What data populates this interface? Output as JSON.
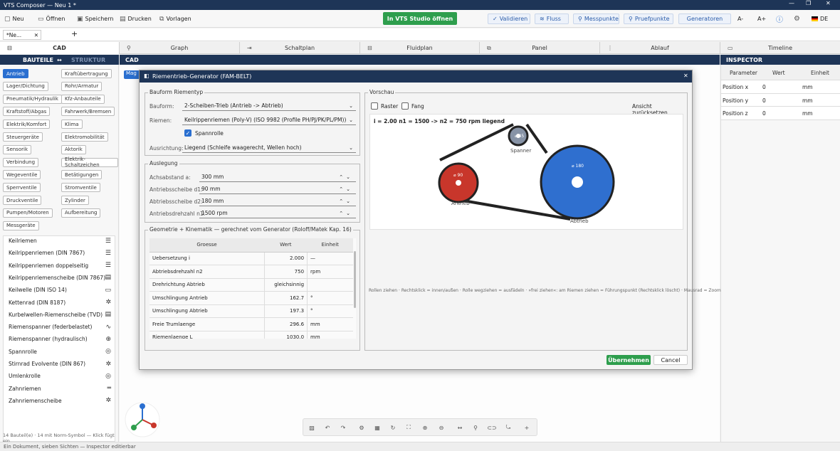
{
  "window": {
    "title": "VTS Composer — Neu 1 *",
    "min": "—",
    "max": "❐",
    "close": "✕"
  },
  "toolbar": {
    "new": "Neu",
    "open": "Öffnen",
    "save": "Speichern",
    "print": "Drucken",
    "templates": "Vorlagen",
    "open_studio": "In VTS Studio öffnen",
    "validate": "Validieren",
    "flow": "Fluss",
    "measure_points": "Messpunkte",
    "check_points": "Pruefpunkte",
    "generators": "Generatoren",
    "font_smaller": "A-",
    "font_larger": "A+",
    "language": "DE"
  },
  "doc_tabs": {
    "active": "*Ne...",
    "close": "✕",
    "add": "+"
  },
  "views": {
    "cad": "CAD",
    "graph": "Graph",
    "schaltplan": "Schaltplan",
    "fluidplan": "Fluidplan",
    "panel": "Panel",
    "ablauf": "Ablauf",
    "timeline": "Timeline"
  },
  "nav": {
    "bauteile": "BAUTEILE",
    "swap": "↔",
    "struktur": "STRUKTUR",
    "cad": "CAD",
    "inspector": "INSPECTOR",
    "mag": "Mag"
  },
  "categories": [
    "Antrieb",
    "Kraftübertragung",
    "Lager/Dichtung",
    "Rohr/Armatur",
    "Pneumatik/Hydraulik",
    "Kfz-Anbauteile",
    "Kraftstoff/Abgas",
    "Fahrwerk/Bremsen",
    "Elektrik/Komfort",
    "Klima",
    "Steuergeräte",
    "Elektromobilität",
    "Sensorik",
    "Aktorik",
    "Verbindung",
    "Elektrik-Schaltzeichen",
    "Wegeventile",
    "Betätigungen",
    "Sperrventile",
    "Stromventile",
    "Druckventile",
    "Zylinder",
    "Pumpen/Motoren",
    "Aufbereitung",
    "Messgeräte"
  ],
  "components": [
    {
      "label": "Keilriemen",
      "icon": "☰"
    },
    {
      "label": "Keilrippenriemen (DIN 7867)",
      "icon": "☰"
    },
    {
      "label": "Keilrippenriemen doppelseitig",
      "icon": "☰"
    },
    {
      "label": "Keilrippenriemenscheibe (DIN 7867)",
      "icon": "▤"
    },
    {
      "label": "Keilwelle (DIN ISO 14)",
      "icon": "▭"
    },
    {
      "label": "Kettenrad (DIN 8187)",
      "icon": "✲"
    },
    {
      "label": "Kurbelwellen-Riemenscheibe (TVD)",
      "icon": "▤"
    },
    {
      "label": "Riemenspanner (federbelastet)",
      "icon": "∿"
    },
    {
      "label": "Riemenspanner (hydraulisch)",
      "icon": "⊕"
    },
    {
      "label": "Spannrolle",
      "icon": "◎"
    },
    {
      "label": "Stirnrad Evolvente (DIN 867)",
      "icon": "✲"
    },
    {
      "label": "Umlenkrolle",
      "icon": "◎"
    },
    {
      "label": "Zahnriemen",
      "icon": "═"
    },
    {
      "label": "Zahnriemenscheibe",
      "icon": "✲"
    }
  ],
  "left_footer": "14 Bauteil(e) · 14 mit Norm-Symbol — Klick fügt ein.",
  "inspector": {
    "headers": [
      "Parameter",
      "Wert",
      "Einheit"
    ],
    "rows": [
      [
        "Position x",
        "0",
        "mm"
      ],
      [
        "Position y",
        "0",
        "mm"
      ],
      [
        "Position z",
        "0",
        "mm"
      ]
    ]
  },
  "status": "Ein Dokument, sieben Sichten — Inspector editierbar",
  "dialog": {
    "title": "Riementrieb-Generator (FAM-BELT)",
    "close": "✕",
    "bauform": {
      "group": "Bauform  Riementyp",
      "bauform_label": "Bauform:",
      "bauform_value": "2-Scheiben-Trieb (Antrieb -> Abtrieb)",
      "riemen_label": "Riemen:",
      "riemen_value": "Keilrippenriemen (Poly-V)  (ISO 9982 (Profile PH/PJ/PK/PL/PM))",
      "spannrolle": "Spannrolle",
      "ausrichtung_label": "Ausrichtung:",
      "ausrichtung_value": "Liegend (Schleife waagerecht, Wellen hoch)"
    },
    "auslegung": {
      "group": "Auslegung",
      "rows": [
        {
          "label": "Achsabstand a:",
          "value": "300 mm"
        },
        {
          "label": "Antriebsscheibe d1:",
          "value": "90 mm"
        },
        {
          "label": "Abtriebsscheibe d2:",
          "value": "180 mm"
        },
        {
          "label": "Antriebsdrehzahl n1:",
          "value": "1500 rpm"
        }
      ]
    },
    "geometrie": {
      "group": "Geometrie + Kinematik  —  gerechnet vom Generator (Roloff/Matek Kap. 16)",
      "headers": [
        "Groesse",
        "Wert",
        "Einheit"
      ],
      "rows": [
        [
          "Uebersetzung i",
          "2.000",
          "—"
        ],
        [
          "Abtriebsdrehzahl n2",
          "750",
          "rpm"
        ],
        [
          "Drehrichtung Abtrieb",
          "gleichsinnig",
          ""
        ],
        [
          "Umschlingung Antrieb",
          "162.7",
          "°"
        ],
        [
          "Umschlingung Abtrieb",
          "197.3",
          "°"
        ],
        [
          "Freie Trumlaenge",
          "296.6",
          "mm"
        ],
        [
          "Riemenlaenge L",
          "1030.0",
          "mm"
        ]
      ]
    },
    "vorschau": {
      "group": "Vorschau",
      "raster": "Raster",
      "fang": "Fang",
      "reset": "Ansicht zurücksetzen",
      "info": "i = 2.00    n1 = 1500  ->  n2 = 750 rpm    liegend",
      "antrieb_d": "⌀ 90",
      "antrieb": "Antrieb",
      "abtrieb_d": "⌀ 180",
      "abtrieb": "Abtrieb",
      "spanner_d": "⌀ 45",
      "spanner": "Spanner",
      "hint": "Rollen ziehen · Rechtsklick = innen/außen · Rolle wegziehen = ausfädeln · »frei ziehen«: am Riemen ziehen = Führungspunkt (Rechtsklick löscht) · Mausrad = Zoom"
    },
    "apply": "Übernehmen",
    "cancel": "Cancel"
  },
  "colors": {
    "navy": "#1e3557",
    "green": "#2e9e4d",
    "blue": "#2a6fd0",
    "red": "#c8362b",
    "pulley_blue": "#2f6fcf"
  }
}
